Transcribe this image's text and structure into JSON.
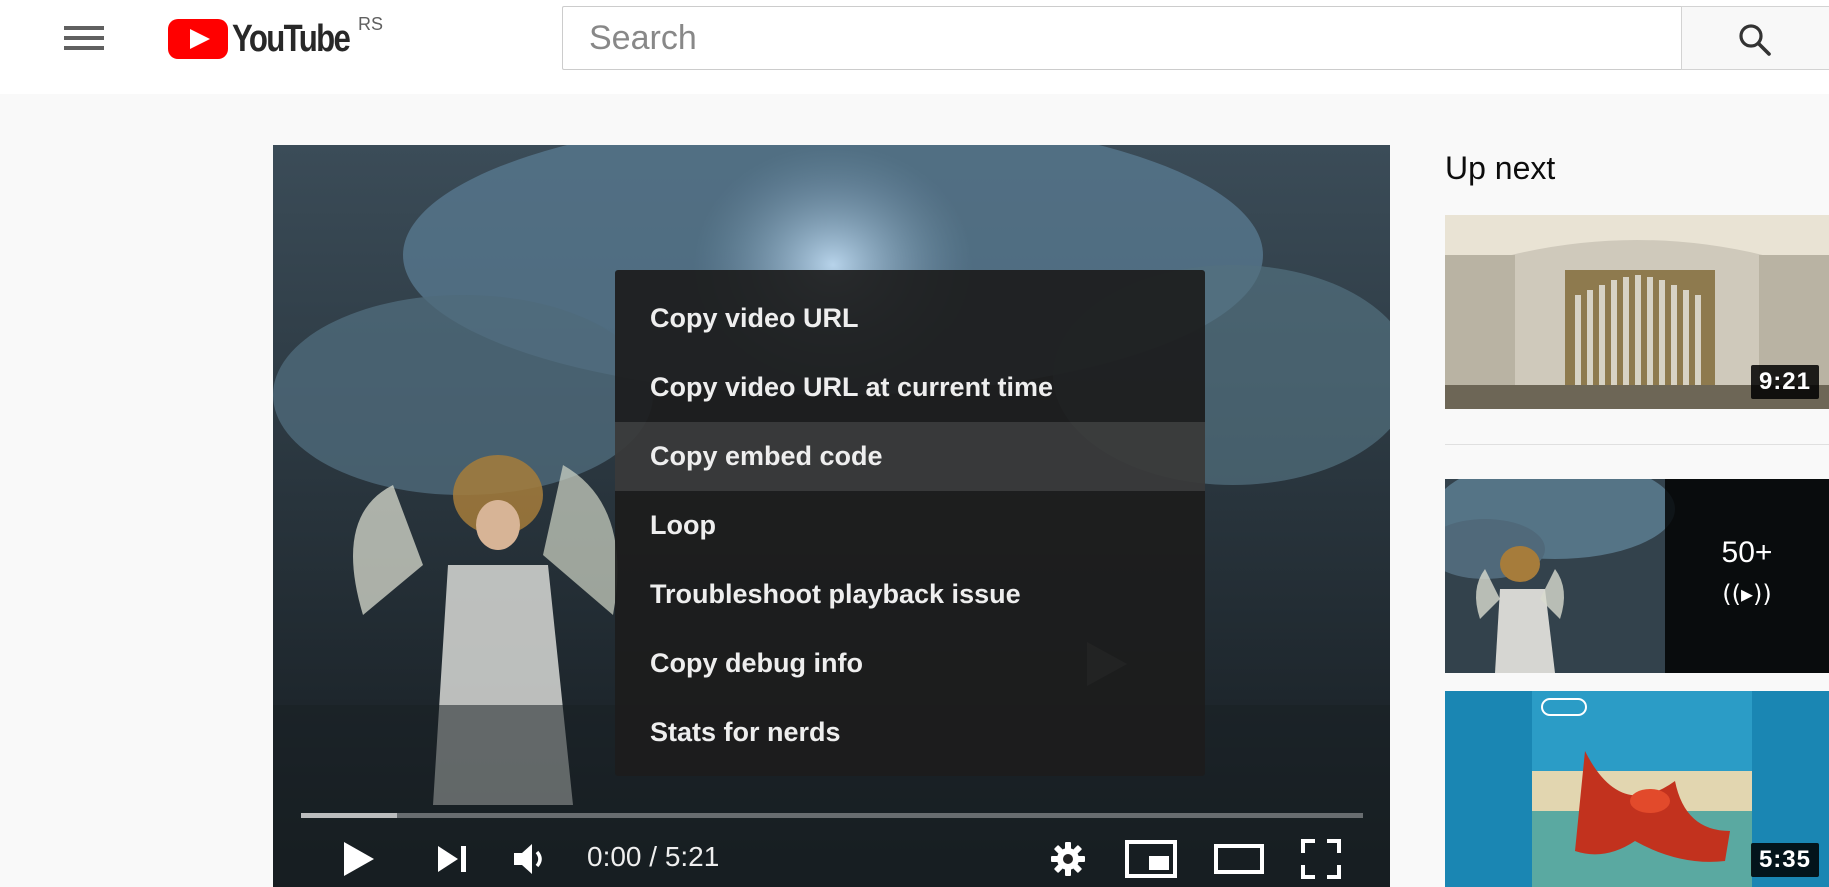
{
  "header": {
    "logo_text": "YouTube",
    "region_code": "RS",
    "search_placeholder": "Search"
  },
  "player": {
    "time_display": "0:00 / 5:21",
    "progress_loaded_fraction": 0.09
  },
  "context_menu": {
    "items": [
      {
        "label": "Copy video URL"
      },
      {
        "label": "Copy video URL at current time"
      },
      {
        "label": "Copy embed code"
      },
      {
        "label": "Loop"
      },
      {
        "label": "Troubleshoot playback issue"
      },
      {
        "label": "Copy debug info"
      },
      {
        "label": "Stats for nerds"
      }
    ],
    "highlighted_index": 2
  },
  "sidebar": {
    "title": "Up next",
    "videos": [
      {
        "duration": "9:21"
      },
      {
        "mix_count": "50+",
        "mix_icon": "((▸))"
      },
      {
        "duration": "5:35"
      }
    ]
  },
  "colors": {
    "brand_red": "#ff0000",
    "menu_bg": "#1c1c1c",
    "page_bg": "#f9f9f9"
  }
}
